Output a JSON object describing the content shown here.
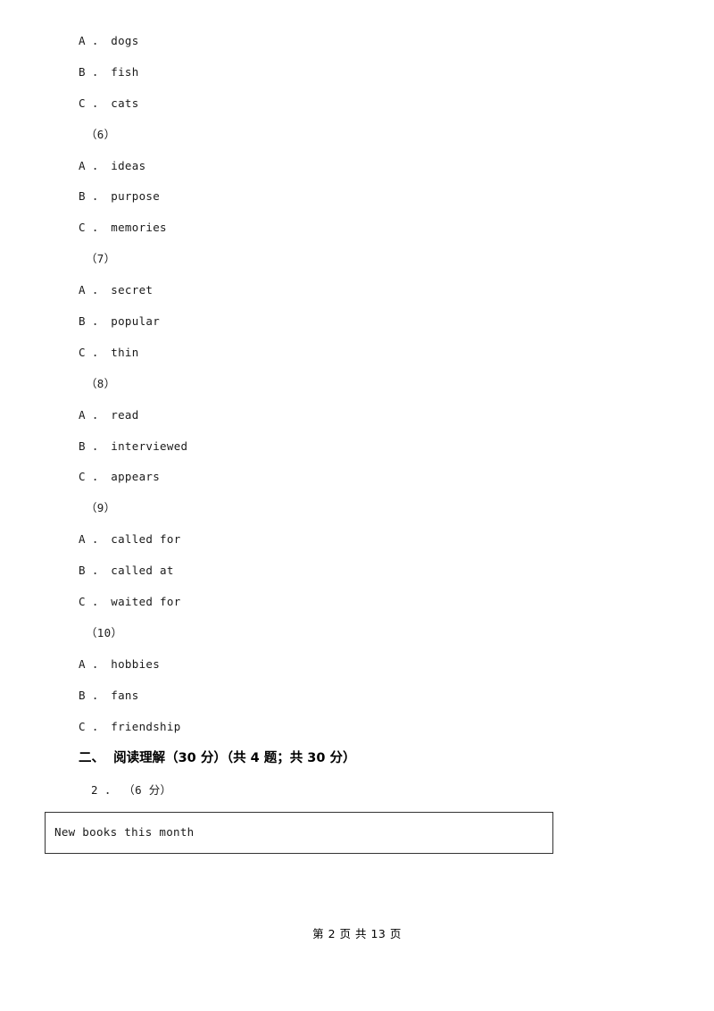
{
  "document": {
    "options_block": [
      "A ． dogs",
      "B ． fish",
      "C ． cats"
    ],
    "groups": [
      {
        "number": "（6）",
        "options": [
          "A ． ideas",
          "B ． purpose",
          "C ． memories"
        ]
      },
      {
        "number": "（7）",
        "options": [
          "A ． secret",
          "B ． popular",
          "C ． thin"
        ]
      },
      {
        "number": "（8）",
        "options": [
          "A ． read",
          "B ． interviewed",
          "C ． appears"
        ]
      },
      {
        "number": "（9）",
        "options": [
          "A ． called for",
          "B ． called at",
          "C ． waited for"
        ]
      },
      {
        "number": "（10）",
        "options": [
          "A ． hobbies",
          "B ． fans",
          "C ． friendship"
        ]
      }
    ],
    "section_heading": "二、  阅读理解（30 分）（共 4 题；共 30 分）",
    "sub_question": "2 ． （6 分）",
    "reading_box_text": "New books this month",
    "footer": "第 2 页 共 13 页"
  }
}
